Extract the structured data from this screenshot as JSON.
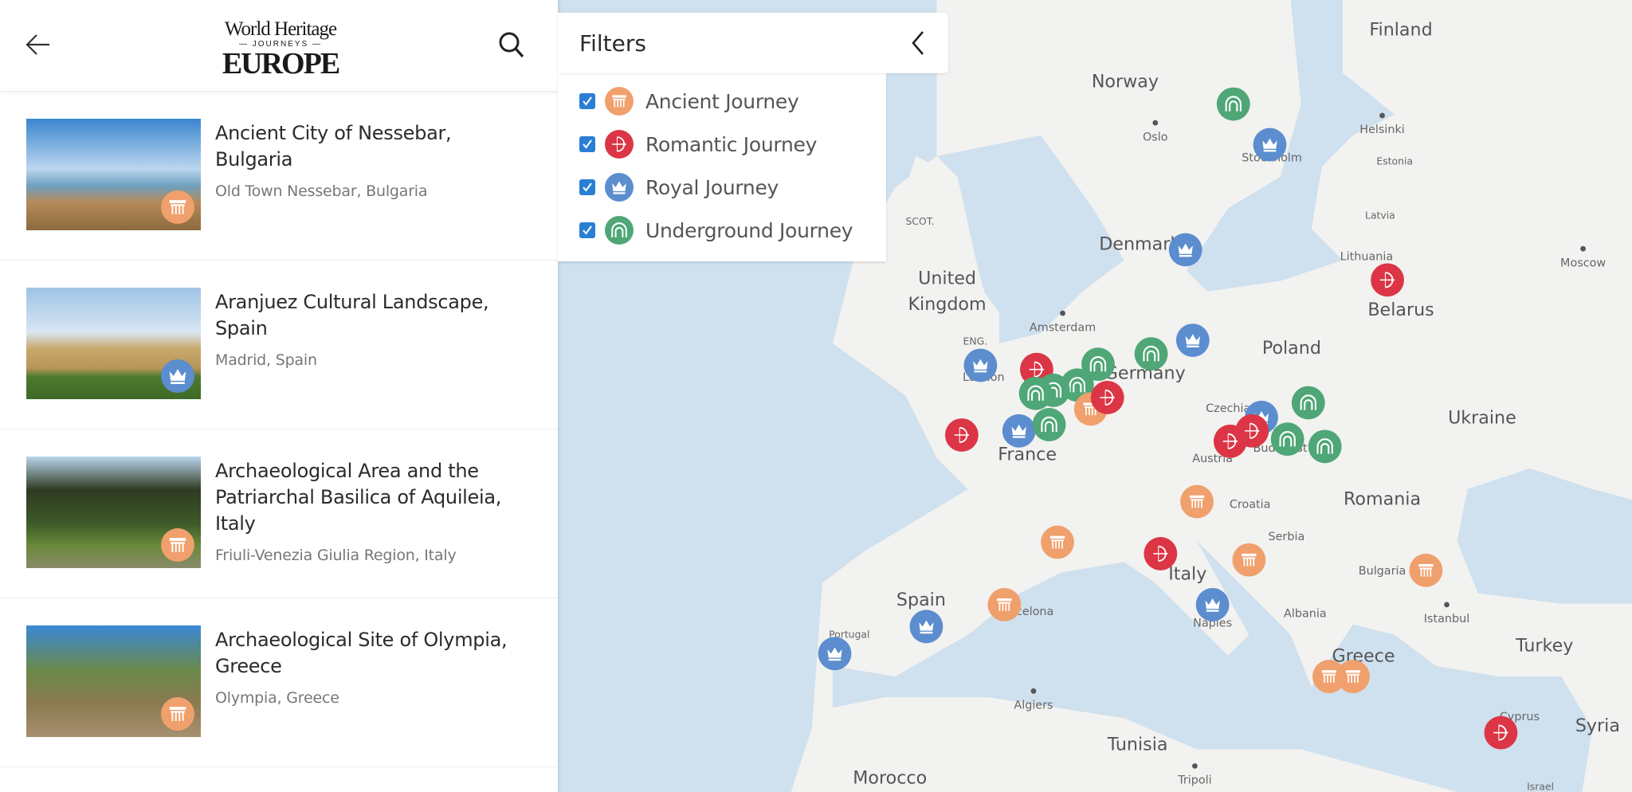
{
  "header": {
    "logo_line1": "World Heritage",
    "logo_line2": "— JOURNEYS —",
    "logo_line3": "EUROPE",
    "back_icon": "arrow-left-icon",
    "search_icon": "search-icon"
  },
  "journeys": {
    "ancient": {
      "label": "Ancient Journey",
      "color": "#f0a06c",
      "icon": "column-icon"
    },
    "romantic": {
      "label": "Romantic Journey",
      "color": "#dc3545",
      "icon": "bow-arrow-icon"
    },
    "royal": {
      "label": "Royal Journey",
      "color": "#5b8dcf",
      "icon": "crown-icon"
    },
    "underground": {
      "label": "Underground Journey",
      "color": "#4fa676",
      "icon": "arch-icon"
    }
  },
  "filters": {
    "title": "Filters",
    "items": [
      {
        "key": "ancient",
        "label": "Ancient Journey",
        "checked": true
      },
      {
        "key": "romantic",
        "label": "Romantic Journey",
        "checked": true
      },
      {
        "key": "royal",
        "label": "Royal Journey",
        "checked": true
      },
      {
        "key": "underground",
        "label": "Underground Journey",
        "checked": true
      }
    ]
  },
  "list": [
    {
      "title": "Ancient City of Nessebar, Bulgaria",
      "location": "Old Town Nessebar, Bulgaria",
      "journey": "ancient"
    },
    {
      "title": "Aranjuez Cultural Landscape, Spain",
      "location": "Madrid, Spain",
      "journey": "royal"
    },
    {
      "title": "Archaeological Area and the Patriarchal Basilica of Aquileia, Italy",
      "location": "Friuli-Venezia Giulia Region, Italy",
      "journey": "ancient"
    },
    {
      "title": "Archaeological Site of Olympia, Greece",
      "location": "Olympia, Greece",
      "journey": "ancient"
    }
  ],
  "map": {
    "labels": [
      "Finland",
      "Norway",
      "Oslo",
      "Helsinki",
      "Estonia",
      "Stockholm",
      "Latvia",
      "SCOT.",
      "Denmark",
      "Lithuania",
      "Moscow",
      "United",
      "Kingdom",
      "Belarus",
      "Amsterdam",
      "ENG.",
      "Poland",
      "Germany",
      "London",
      "Czechia",
      "Ukraine",
      "France",
      "Austria",
      "Budapest",
      "Croatia",
      "Romania",
      "Serbia",
      "Italy",
      "Bulgaria",
      "Spain",
      "Barcelona",
      "Portugal",
      "Naples",
      "Albania",
      "Istanbul",
      "Turkey",
      "Greece",
      "Algiers",
      "Tunisia",
      "Syria",
      "Morocco",
      "Tripoli",
      "Israel",
      "Cyprus"
    ]
  }
}
